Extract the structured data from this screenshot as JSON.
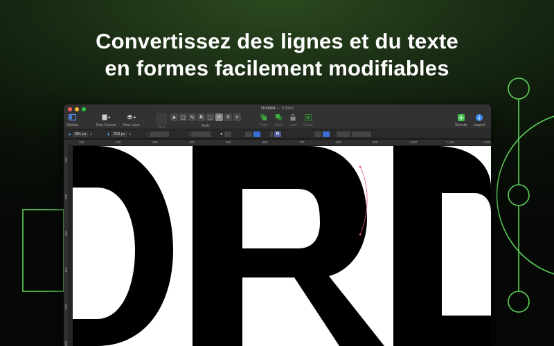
{
  "headline": {
    "line1": "Convertissez des lignes et du texte",
    "line2": "en formes facilement modifiables"
  },
  "colors": {
    "accent_green": "#5fd35a",
    "background_dark": "#0a1109",
    "selection_path": "#e0557a"
  },
  "window": {
    "title": "Untitled",
    "separator": "—",
    "status": "Edited"
  },
  "toolbar": {
    "sidebar_label": "Sidebar",
    "new_canvas_label": "New Canvas",
    "new_layer_label": "New Layer",
    "style_label": "Style",
    "tools_label": "Tools",
    "front_label": "Front",
    "back_label": "Back",
    "lock_label": "Lock",
    "group_label": "Group",
    "stencils_label": "Stencils",
    "inspect_label": "Inspect",
    "tools": [
      "arrow",
      "rectangle",
      "pen",
      "text",
      "frame",
      "node",
      "grid",
      "more"
    ]
  },
  "options_bar": {
    "x_value": "881 px",
    "y_value": "253 px"
  },
  "ruler": {
    "h_ticks": [
      "100",
      "200",
      "300",
      "400",
      "500",
      "600",
      "700",
      "800",
      "900",
      "1,000",
      "1,100",
      "1,200"
    ],
    "v_ticks": [
      "100",
      "200",
      "300",
      "400",
      "500",
      "600"
    ]
  }
}
